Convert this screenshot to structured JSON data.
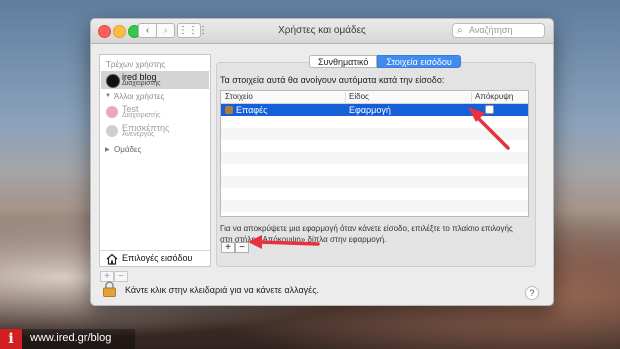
{
  "window": {
    "title": "Χρήστες και ομάδες",
    "search_placeholder": "Αναζήτηση"
  },
  "sidebar": {
    "current_users_label": "Τρέχων χρήστης",
    "current_user": {
      "name": "ired blog",
      "role": "Διαχειριστής"
    },
    "other_users_label": "Άλλοι χρήστες",
    "other_users": [
      {
        "name": "Test",
        "role": "Διαχειριστής"
      },
      {
        "name": "Επισκέπτης",
        "role": "Ανενεργός"
      }
    ],
    "groups_label": "Ομάδες",
    "login_options_label": "Επιλογές εισόδου",
    "add_label": "+",
    "remove_label": "−"
  },
  "tabs": [
    {
      "label": "Συνθηματικό",
      "active": false
    },
    {
      "label": "Στοιχεία εισόδου",
      "active": true
    }
  ],
  "login_items": {
    "heading": "Τα στοιχεία αυτά θα ανοίγουν αυτόματα κατά την είσοδο:",
    "columns": [
      "Στοιχείο",
      "Είδος",
      "Απόκρυψη"
    ],
    "rows": [
      {
        "item": "Επαφές",
        "kind": "Εφαρμογή",
        "hide": false
      }
    ],
    "note": "Για να αποκρύψετε μια εφαρμογή όταν κάνετε είσοδο, επιλέξτε το πλαίσιο επιλογής στη στήλη «Απόκρυψη» δίπλα στην εφαρμογή.",
    "add_label": "+",
    "remove_label": "−"
  },
  "lock": {
    "text": "Κάντε κλικ στην κλειδαριά για να κάνετε αλλαγές."
  },
  "help_label": "?",
  "footer": {
    "badge": "i",
    "url": "www.ired.gr/blog"
  },
  "colors": {
    "accent": "#3f8bf0",
    "selection": "#1560d8",
    "annotation_arrow": "#e8313f"
  }
}
